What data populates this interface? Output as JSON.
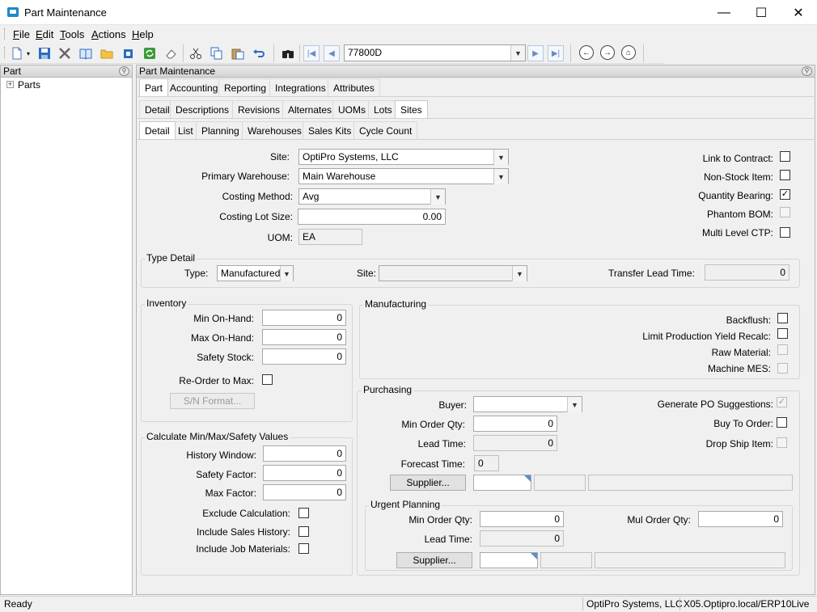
{
  "window": {
    "title": "Part Maintenance",
    "minimize": "—",
    "maximize": "☐",
    "close": "✕"
  },
  "menu": {
    "items": [
      {
        "underline": "F",
        "rest": "ile"
      },
      {
        "underline": "E",
        "rest": "dit"
      },
      {
        "underline": "T",
        "rest": "ools"
      },
      {
        "underline": "A",
        "rest": "ctions"
      },
      {
        "underline": "H",
        "rest": "elp"
      }
    ]
  },
  "toolbar": {
    "part_number": "77800D",
    "icons": [
      "new-icon",
      "save-icon",
      "delete-icon",
      "book-icon",
      "open-folder-icon",
      "attachment-icon",
      "refresh-icon",
      "clear-icon",
      "cut-icon",
      "copy-icon",
      "paste-icon",
      "undo-icon",
      "search-binoculars-icon"
    ]
  },
  "left_panel": {
    "header": "Part",
    "tree_root": "Parts",
    "expander": "+"
  },
  "main_panel": {
    "header": "Part Maintenance",
    "tabs_level1": [
      "Part",
      "Accounting",
      "Reporting",
      "Integrations",
      "Attributes"
    ],
    "tabs_level2": [
      "Detail",
      "Descriptions",
      "Revisions",
      "Alternates",
      "UOMs",
      "Lots",
      "Sites"
    ],
    "tabs_level3": [
      "Detail",
      "List",
      "Planning",
      "Warehouses",
      "Sales Kits",
      "Cycle Count"
    ]
  },
  "site_detail": {
    "site_label": "Site:",
    "site_value": "OptiPro Systems, LLC",
    "primary_wh_label": "Primary Warehouse:",
    "primary_wh_value": "Main Warehouse",
    "costing_method_label": "Costing Method:",
    "costing_method_value": "Avg",
    "costing_lot_label": "Costing Lot Size:",
    "costing_lot_value": "0.00",
    "uom_label": "UOM:",
    "uom_value": "EA",
    "link_contract_label": "Link to Contract:",
    "non_stock_label": "Non-Stock Item:",
    "qty_bearing_label": "Quantity Bearing:",
    "phantom_label": "Phantom BOM:",
    "multi_ctp_label": "Multi Level CTP:",
    "checks": {
      "link_contract": false,
      "non_stock": false,
      "qty_bearing": true,
      "phantom": false,
      "multi_ctp": false
    }
  },
  "type_detail": {
    "title": "Type Detail",
    "type_label": "Type:",
    "type_value": "Manufactured",
    "site_label": "Site:",
    "site_value": "",
    "transfer_label": "Transfer Lead Time:",
    "transfer_value": "0"
  },
  "inventory": {
    "title": "Inventory",
    "min_label": "Min On-Hand:",
    "min_value": "0",
    "max_label": "Max On-Hand:",
    "max_value": "0",
    "safety_label": "Safety Stock:",
    "safety_value": "0",
    "reorder_label": "Re-Order to Max:",
    "sn_button": "S/N Format..."
  },
  "calc": {
    "title": "Calculate Min/Max/Safety Values",
    "history_label": "History Window:",
    "history_value": "0",
    "safety_factor_label": "Safety Factor:",
    "safety_factor_value": "0",
    "max_factor_label": "Max Factor:",
    "max_factor_value": "0",
    "exclude_label": "Exclude Calculation:",
    "sales_label": "Include Sales History:",
    "job_label": "Include Job Materials:"
  },
  "manufacturing": {
    "title": "Manufacturing",
    "backflush_label": "Backflush:",
    "limit_label": "Limit Production Yield Recalc:",
    "raw_label": "Raw Material:",
    "mes_label": "Machine MES:"
  },
  "purchasing": {
    "title": "Purchasing",
    "buyer_label": "Buyer:",
    "buyer_value": "",
    "min_order_label": "Min Order Qty:",
    "min_order_value": "0",
    "lead_label": "Lead Time:",
    "lead_value": "0",
    "forecast_label": "Forecast Time:",
    "forecast_value": "0",
    "supplier_button": "Supplier...",
    "gen_po_label": "Generate PO Suggestions:",
    "buy_to_order_label": "Buy To Order:",
    "drop_ship_label": "Drop Ship Item:",
    "gen_po_checked": true
  },
  "urgent": {
    "title": "Urgent Planning",
    "min_order_label": "Min Order Qty:",
    "min_order_value": "0",
    "mul_order_label": "Mul Order Qty:",
    "mul_order_value": "0",
    "lead_label": "Lead Time:",
    "lead_value": "0",
    "supplier_button": "Supplier..."
  },
  "status": {
    "state": "Ready",
    "company": "OptiPro Systems, LLC",
    "server": "X05.Optipro.local/ERP10Live"
  },
  "colors": {
    "accent": "#1e88c8",
    "panel_header": "#d4d4d4"
  }
}
